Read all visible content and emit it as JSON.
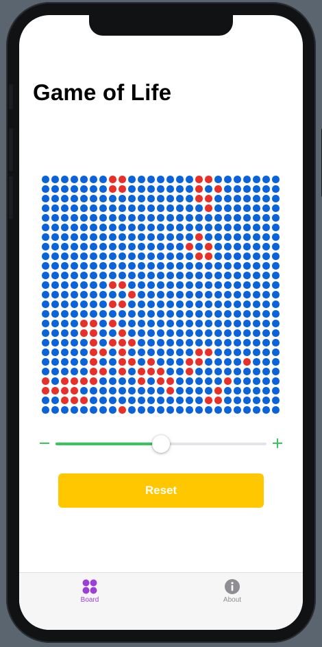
{
  "app": {
    "title": "Game of Life"
  },
  "board": {
    "rows": 25,
    "cols": 25,
    "colors": {
      "dead": "#0a63d9",
      "alive": "#e8302a"
    },
    "grid": [
      "0000000110000000110000000",
      "0000000110000000101000000",
      "0000000000000000110000000",
      "0000000000000000010000000",
      "0000000000000000000000000",
      "0000000000000000000000000",
      "0000000000000000100000000",
      "0000000000000001010000000",
      "0000000000000000110000000",
      "0000000000000000000000000",
      "0000000000000000000000000",
      "0000000110000000000000000",
      "0000000001000000000000000",
      "0000000110000000000000000",
      "0000000000000000000000000",
      "0000110100000000000000000",
      "0000110010000000000000000",
      "0000010111000000000000000",
      "0000011010000000110000000",
      "0000010011010001100001000",
      "0000011010111001000000000",
      "1011110000101100000100000",
      "1111000000000100001000000",
      "0011100000000000011000000",
      "0000000010000000000000000"
    ]
  },
  "speed": {
    "value": 0.5,
    "min_icon": "minus-icon",
    "max_icon": "plus-icon",
    "accent": "#34c759"
  },
  "actions": {
    "reset_label": "Reset",
    "reset_color": "#ffc700"
  },
  "tabs": [
    {
      "label": "Board",
      "icon": "four-dots-icon",
      "selected": true,
      "color": "#9b3fd6"
    },
    {
      "label": "About",
      "icon": "info-circle-icon",
      "selected": false,
      "color": "#8e8e93"
    }
  ]
}
